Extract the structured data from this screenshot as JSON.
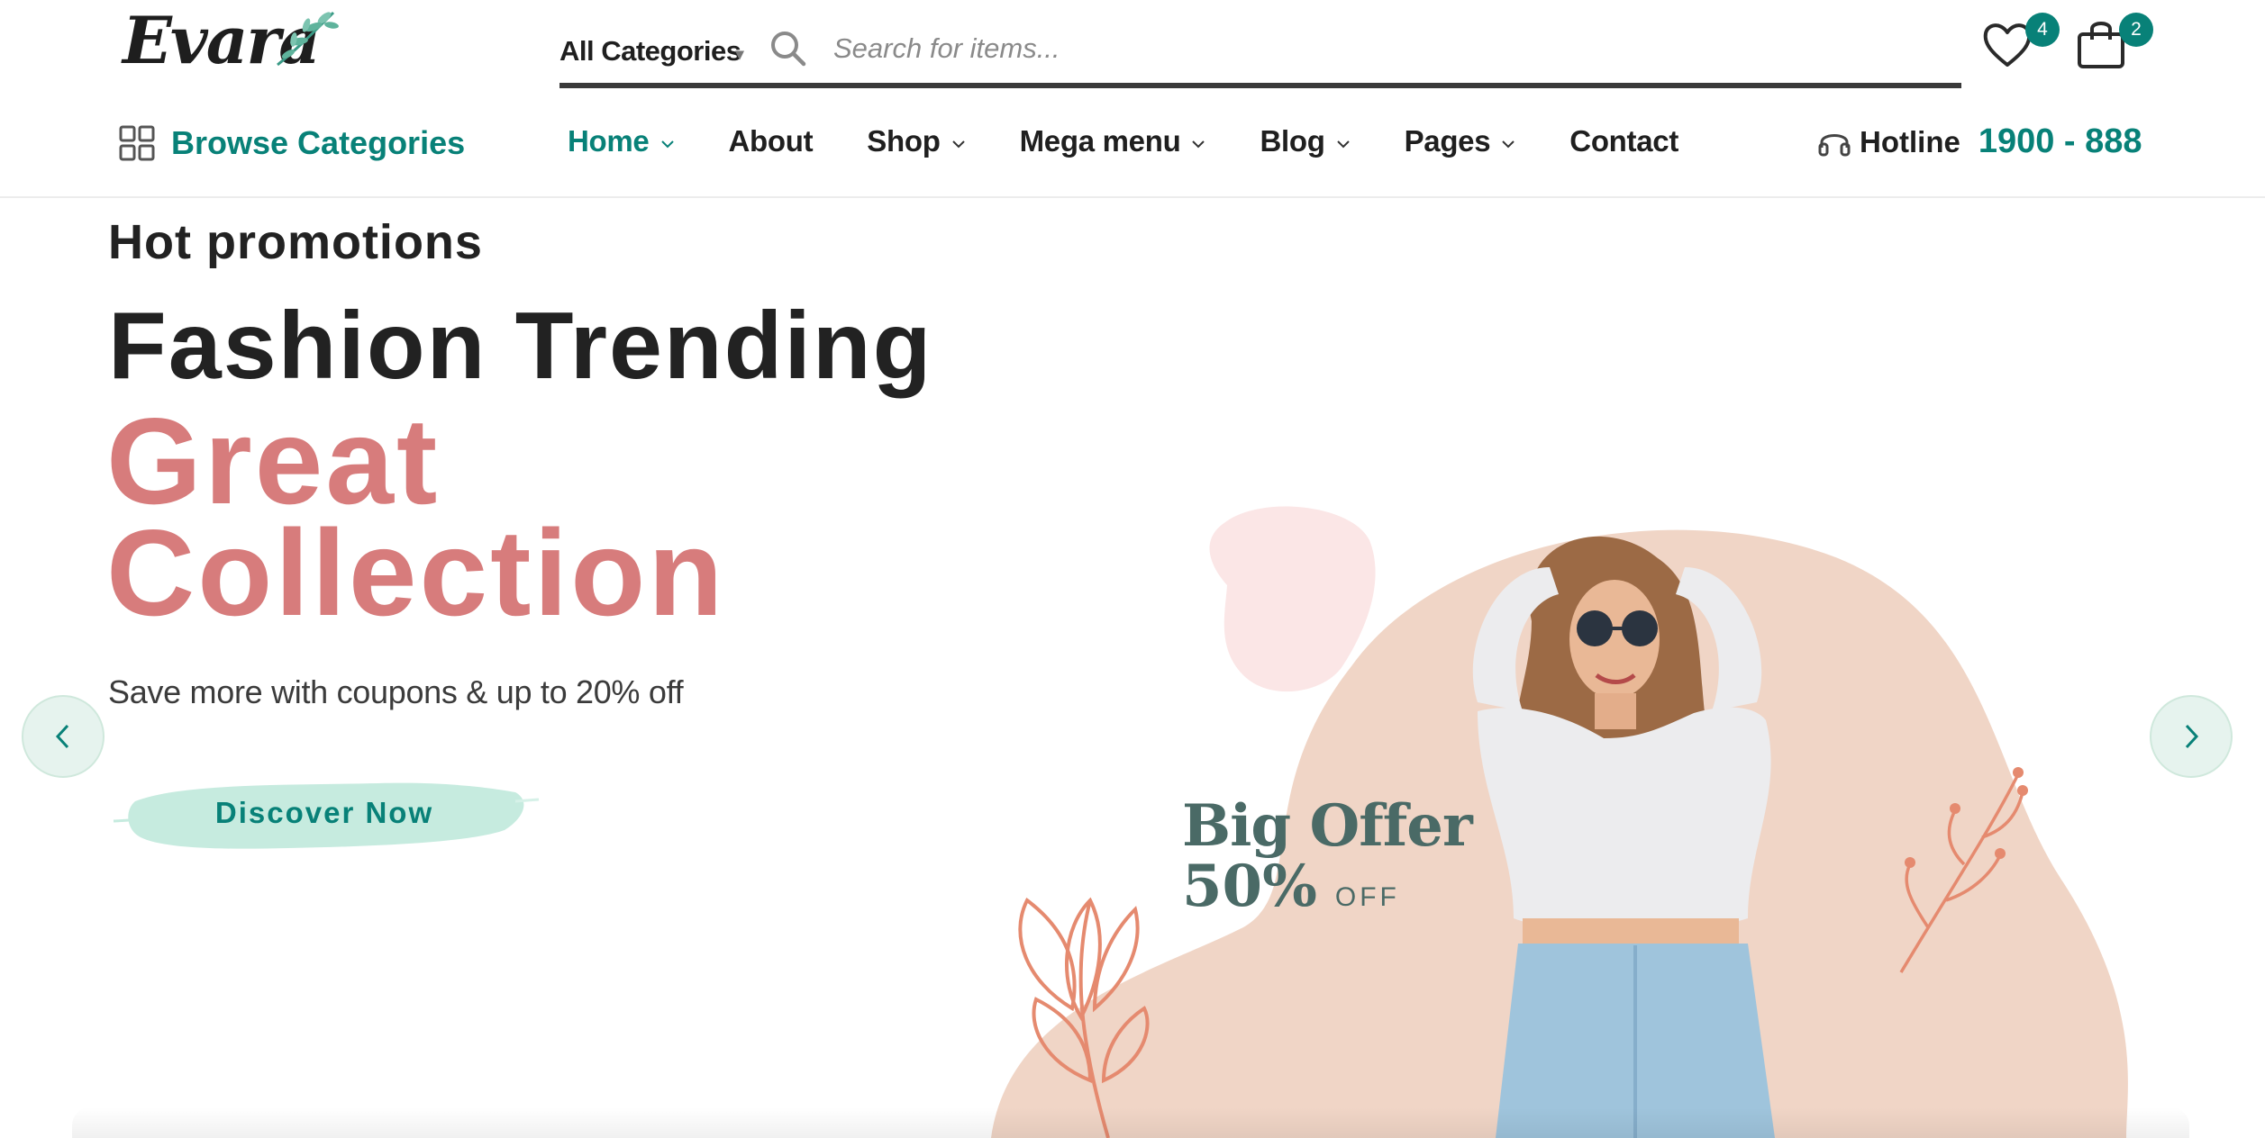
{
  "header": {
    "logo_text": "Evara",
    "category_select": "All Categories",
    "search_placeholder": "Search for items...",
    "wishlist_count": "4",
    "cart_count": "2"
  },
  "nav": {
    "browse_label": "Browse Categories",
    "items": [
      {
        "label": "Home",
        "dropdown": true,
        "active": true
      },
      {
        "label": "About",
        "dropdown": false
      },
      {
        "label": "Shop",
        "dropdown": true
      },
      {
        "label": "Mega menu",
        "dropdown": true
      },
      {
        "label": "Blog",
        "dropdown": true
      },
      {
        "label": "Pages",
        "dropdown": true
      },
      {
        "label": "Contact",
        "dropdown": false
      }
    ],
    "hotline_label": "Hotline",
    "hotline_number": "1900 - 888"
  },
  "hero": {
    "subtitle": "Hot promotions",
    "title": "Fashion Trending",
    "accent_line1": "Great",
    "accent_line2": "Collection",
    "description": "Save more with coupons & up to 20% off",
    "cta_label": "Discover Now",
    "offer_line1": "Big Offer",
    "offer_percent": "50%",
    "offer_suffix": "OFF"
  },
  "colors": {
    "brand": "#088178",
    "accent": "#d77c7c",
    "cta_bg": "#c6ebdf",
    "blob": "#f0d5c6",
    "offer_text": "#4a6a66"
  }
}
